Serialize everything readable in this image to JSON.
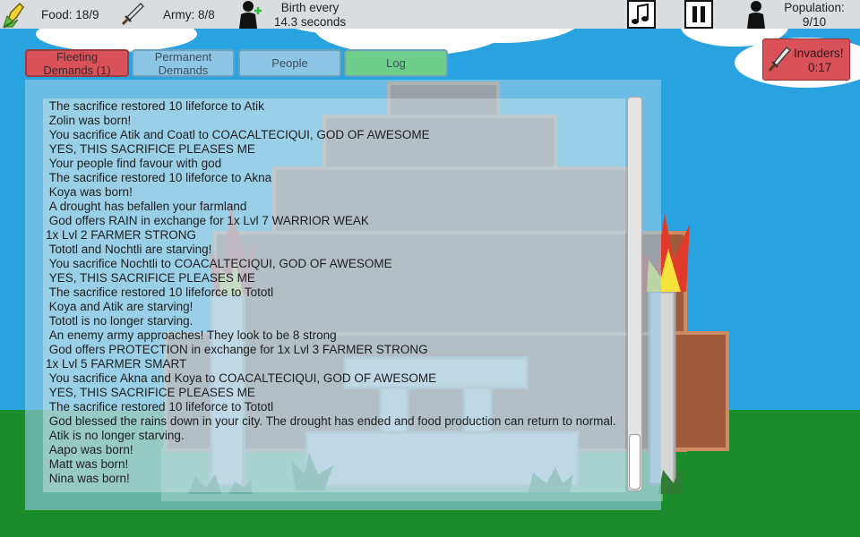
{
  "hud": {
    "food_label": "Food: 18/9",
    "army_label": "Army: 8/8",
    "birth_line1": "Birth every",
    "birth_line2": "14.3 seconds",
    "population_line1": "Population:",
    "population_line2": "9/10"
  },
  "tabs": [
    {
      "label": "Fleeting\nDemands (1)",
      "color": "#d9525a"
    },
    {
      "label": "Permanent\nDemands",
      "color": "#8cc6e4"
    },
    {
      "label": "People",
      "color": "#8cc6e4"
    },
    {
      "label": "Log",
      "color": "#6fcf8a"
    }
  ],
  "invaders": {
    "label": "Invaders!",
    "timer": "0:17"
  },
  "log": {
    "lines": [
      " The sacrifice restored 10 lifeforce to Atik",
      " Zolin was born!",
      " You sacrifice Atik and Coatl to COACALTECIQUI, GOD OF AWESOME",
      " YES, THIS SACRIFICE PLEASES ME",
      " Your people find favour with god",
      " The sacrifice restored 10 lifeforce to Akna",
      " Koya was born!",
      " A drought has befallen your farmland",
      " God offers RAIN in exchange for 1x Lvl 7 WARRIOR WEAK",
      "1x Lvl 2 FARMER STRONG",
      " Tototl and Nochtli are starving!",
      " You sacrifice Nochtli to COACALTECIQUI, GOD OF AWESOME",
      " YES, THIS SACRIFICE PLEASES ME",
      " The sacrifice restored 10 lifeforce to Tototl",
      " Koya and Atik are starving!",
      " Tototl is no longer starving.",
      " An enemy army approaches! They look to be 8 strong",
      " God offers PROTECTION in exchange for 1x Lvl 3 FARMER STRONG",
      "1x Lvl 5 FARMER SMART",
      " You sacrifice Akna and Koya to COACALTECIQUI, GOD OF AWESOME",
      " YES, THIS SACRIFICE PLEASES ME",
      " The sacrifice restored 10 lifeforce to Tototl",
      " God blessed the rains down in your city. The drought has ended and food production can return to normal.",
      " Atik is no longer starving.",
      " Aapo was born!",
      " Matt was born!",
      " Nina was born!"
    ]
  },
  "icons": [
    "corn-icon",
    "sword-icon",
    "person-plus-icon",
    "music-note-icon",
    "pause-icon",
    "person-icon"
  ],
  "colors": {
    "sky": "#29a3e0",
    "grass": "#1a8c2a",
    "temple": "#a05a3c",
    "panel": "#96cde8"
  }
}
